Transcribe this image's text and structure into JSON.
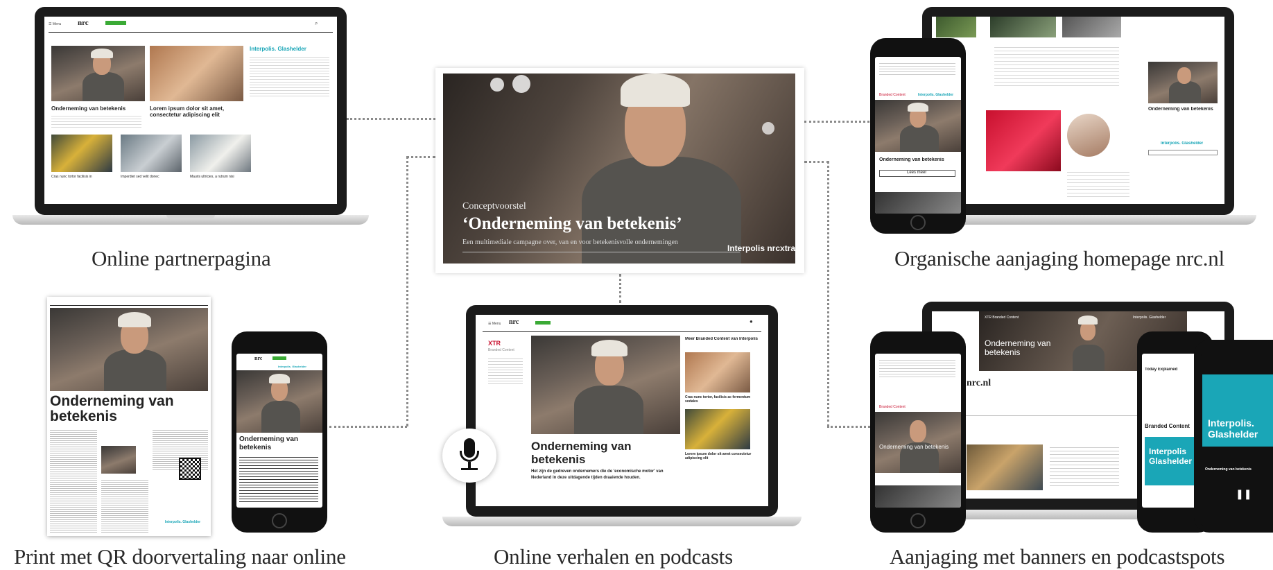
{
  "captions": {
    "partner": "Online partnerpagina",
    "homepage": "Organische aanjaging homepage nrc.nl",
    "print": "Print met QR doorvertaling naar online",
    "stories": "Online verhalen en podcasts",
    "banners": "Aanjaging met banners en podcastspots"
  },
  "hero": {
    "kicker": "Conceptvoorstel",
    "title": "‘Onderneming van betekenis’",
    "subtitle": "Een multimediale campagne over, van en voor betekenisvolle ondernemingen",
    "logo": "Interpolis nrcxtra"
  },
  "partner_page": {
    "brand": "nrc",
    "headline": "Onderneming van betekenis",
    "headline2": "Lorem ipsum dolor sit amet, consectetur adipiscing elit",
    "side_title": "Interpolis. Glashelder",
    "cap1": "Cras nunc tortor facilisis in",
    "cap2": "Imperdiet sed velit donec",
    "cap3": "Mauris ultricies, a rutrum nisi"
  },
  "homepage": {
    "read_more": "Lees meer",
    "branded": "Branded Content",
    "interpolis": "Interpolis. Glashelder",
    "story_headline": "Onderneming van betekenis",
    "side_headline": "Onderneming van betekenis"
  },
  "print": {
    "title": "Onderneming van betekenis",
    "phone_title": "Onderneming van betekenis",
    "footer": "Interpolis. Glashelder"
  },
  "stories": {
    "brand": "nrc",
    "xtr": "XTR",
    "branded": "Branded Content",
    "headline": "Onderneming van betekenis",
    "side_title": "Meer Branded Content van Interpolis",
    "side_cap1": "Cras nunc tortor, facilisis ac fermentum sodales",
    "side_cap2": "Lorem ipsum dolor sit amet consectetur adipiscing elit",
    "body": "Het zijn de gedreven ondernemers die de 'economische motor' van Nederland in deze uitdagende tijden draaiende houden."
  },
  "banners": {
    "branded": "XTR Branded Content",
    "interpolis": "Interpolis. Glashelder",
    "banner_title": "Onderneming van betekenis",
    "brand": "nrc.nl",
    "tile_title": "Interpolis. Glashelder",
    "tile_title2": "Interpolis Glashelder",
    "player_title": "Onderneming van betekenis",
    "today": "Today Explained",
    "section": "Branded Content"
  },
  "colors": {
    "accent_teal": "#1aa6b7",
    "accent_red": "#c8102e",
    "green_badge": "#3aaa35"
  }
}
